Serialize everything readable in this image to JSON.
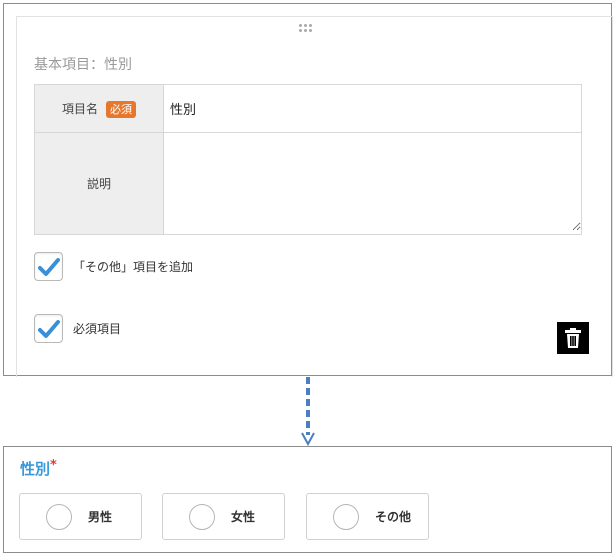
{
  "editor": {
    "section_title": "基本項目：性別",
    "field_name_label": "項目名",
    "required_badge": "必須",
    "field_name_value": "性別",
    "description_label": "説明",
    "description_value": "",
    "add_other_label": "「その他」項目を追加",
    "add_other_checked": true,
    "required_label": "必須項目",
    "required_checked": true,
    "check_color": "#3a8fd9"
  },
  "preview": {
    "title": "性別",
    "required_mark": "*",
    "options": [
      "男性",
      "女性",
      "その他"
    ],
    "title_color": "#3a9ad9"
  }
}
